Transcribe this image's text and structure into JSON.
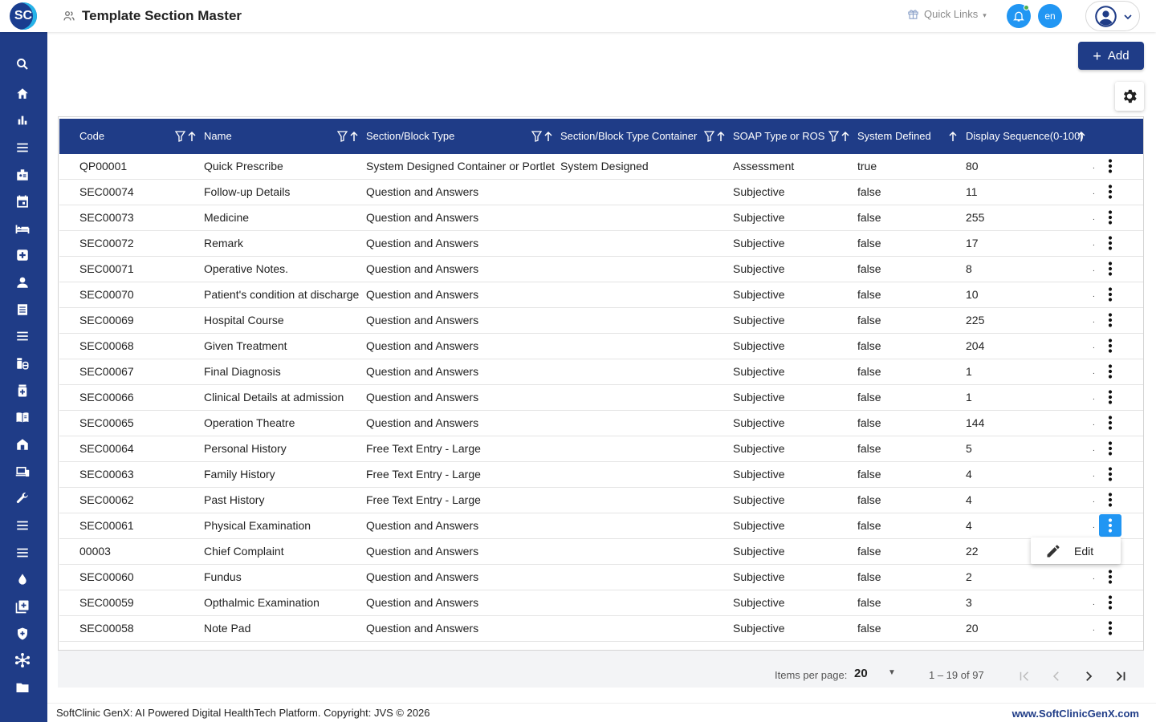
{
  "app": {
    "logo_text": "SC",
    "page_title": "Template Section Master"
  },
  "header": {
    "quick_links": "Quick Links",
    "language": "en"
  },
  "toolbar": {
    "add_label": "Add"
  },
  "table": {
    "columns": [
      "Code",
      "Name",
      "Section/Block Type",
      "Section/Block Type Container",
      "SOAP Type or ROS",
      "System Defined",
      "Display Sequence(0-100)"
    ],
    "rows": [
      [
        "QP00001",
        "Quick Prescribe",
        "System Designed Container or Portlet",
        "System Designed",
        "Assessment",
        "true",
        "80"
      ],
      [
        "SEC00074",
        "Follow-up Details",
        "Question and Answers",
        "",
        "Subjective",
        "false",
        "11"
      ],
      [
        "SEC00073",
        "Medicine",
        "Question and Answers",
        "",
        "Subjective",
        "false",
        "255"
      ],
      [
        "SEC00072",
        "Remark",
        "Question and Answers",
        "",
        "Subjective",
        "false",
        "17"
      ],
      [
        "SEC00071",
        "Operative Notes.",
        "Question and Answers",
        "",
        "Subjective",
        "false",
        "8"
      ],
      [
        "SEC00070",
        "Patient's condition at discharge",
        "Question and Answers",
        "",
        "Subjective",
        "false",
        "10"
      ],
      [
        "SEC00069",
        "Hospital Course",
        "Question and Answers",
        "",
        "Subjective",
        "false",
        "225"
      ],
      [
        "SEC00068",
        "Given Treatment",
        "Question and Answers",
        "",
        "Subjective",
        "false",
        "204"
      ],
      [
        "SEC00067",
        "Final Diagnosis",
        "Question and Answers",
        "",
        "Subjective",
        "false",
        "1"
      ],
      [
        "SEC00066",
        "Clinical Details at admission",
        "Question and Answers",
        "",
        "Subjective",
        "false",
        "1"
      ],
      [
        "SEC00065",
        "Operation Theatre",
        "Question and Answers",
        "",
        "Subjective",
        "false",
        "144"
      ],
      [
        "SEC00064",
        "Personal History",
        "Free Text Entry - Large",
        "",
        "Subjective",
        "false",
        "5"
      ],
      [
        "SEC00063",
        "Family History",
        "Free Text Entry - Large",
        "",
        "Subjective",
        "false",
        "4"
      ],
      [
        "SEC00062",
        "Past History",
        "Free Text Entry - Large",
        "",
        "Subjective",
        "false",
        "4"
      ],
      [
        "SEC00061",
        "Physical Examination",
        "Question and Answers",
        "",
        "Subjective",
        "false",
        "4"
      ],
      [
        "00003",
        "Chief Complaint",
        "Question and Answers",
        "",
        "Subjective",
        "false",
        "22"
      ],
      [
        "SEC00060",
        "Fundus",
        "Question and Answers",
        "",
        "Subjective",
        "false",
        "2"
      ],
      [
        "SEC00059",
        "Opthalmic Examination",
        "Question and Answers",
        "",
        "Subjective",
        "false",
        "3"
      ],
      [
        "SEC00058",
        "Note Pad",
        "Question and Answers",
        "",
        "Subjective",
        "false",
        "20"
      ]
    ],
    "active_row": 14
  },
  "row_menu": {
    "edit_label": "Edit"
  },
  "pagination": {
    "items_per_page_label": "Items per page:",
    "page_size": "20",
    "range": "1 – 19 of 97"
  },
  "footer": {
    "copyright": "SoftClinic GenX: AI Powered Digital HealthTech Platform. Copyright: JVS © 2026",
    "website": "www.SoftClinicGenX.com"
  },
  "sidebar": {
    "icons": [
      "search-icon",
      "home-icon",
      "bar-chart-icon",
      "menu-icon",
      "badge-icon",
      "calendar-icon",
      "bed-icon",
      "medical-plus-icon",
      "person-icon",
      "receipt-icon",
      "list-icon",
      "medication-icon",
      "pharmacy-icon",
      "book-icon",
      "building-icon",
      "devices-icon",
      "wrench-icon",
      "menu-icon",
      "list-icon",
      "blood-drop-icon",
      "add-box-icon",
      "shield-icon",
      "hub-icon",
      "folder-icon"
    ]
  },
  "colors": {
    "primary": "#1f3c87",
    "accent": "#2196f3",
    "online": "#4caf50"
  }
}
